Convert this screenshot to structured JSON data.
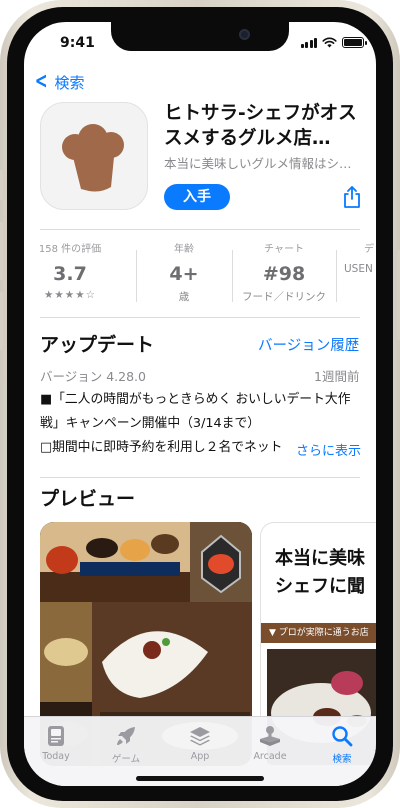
{
  "status": {
    "time": "9:41"
  },
  "nav": {
    "back_label": "検索"
  },
  "app": {
    "title": "ヒトサラ-シェフがオス\nスメするグルメ店…",
    "subtitle": "本当に美味しいグルメ情報はシ…",
    "get_label": "入手"
  },
  "stats": [
    {
      "label": "158 件の評価",
      "value": "3.7",
      "sub": "★★★★☆"
    },
    {
      "label": "年齢",
      "value": "4+",
      "sub": "歳"
    },
    {
      "label": "チャート",
      "value": "#98",
      "sub": "フード／ドリンク"
    },
    {
      "label": "デ",
      "value": "",
      "sub": "USEN"
    }
  ],
  "whatsnew": {
    "title": "アップデート",
    "history_link": "バージョン履歴",
    "version": "バージョン 4.28.0",
    "date": "1週間前",
    "line1": "■「二人の時間がもっときらめく おいしいデート大作",
    "line2": "戦」キャンペーン開催中（3/14まで）",
    "line3": "□期間中に即時予約を利用し２名でネット",
    "more": "さらに表示"
  },
  "preview": {
    "title": "プレビュー",
    "card2_title": "本当に美味\nシェフに聞",
    "card2_bar": "▼ プロが実際に通うお店"
  },
  "tabs": [
    {
      "label": "Today",
      "icon": "today-icon"
    },
    {
      "label": "ゲーム",
      "icon": "rocket-icon"
    },
    {
      "label": "App",
      "icon": "app-stack-icon"
    },
    {
      "label": "Arcade",
      "icon": "arcade-icon"
    },
    {
      "label": "検索",
      "icon": "search-icon"
    }
  ],
  "colors": {
    "accent": "#0a7aff",
    "icon_brown": "#a0694a"
  }
}
